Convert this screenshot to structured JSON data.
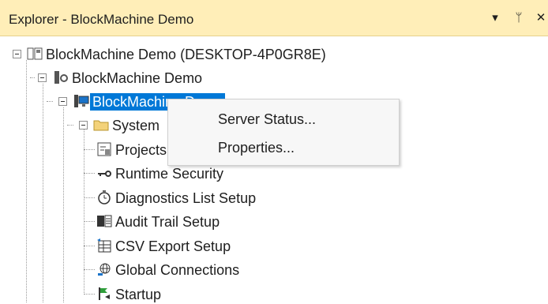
{
  "explorer": {
    "title": "Explorer - BlockMachine Demo",
    "controls": {
      "dropdown": "▾",
      "pin": "ᛘ",
      "close": "✕"
    }
  },
  "tree": {
    "root": "BlockMachine Demo (DESKTOP-4P0GR8E)",
    "project": "BlockMachine Demo",
    "server": "BlockMachine Demo",
    "system": "System",
    "items": [
      {
        "label": "Projects",
        "icon": "project-icon"
      },
      {
        "label": "Runtime Security",
        "icon": "key-icon"
      },
      {
        "label": "Diagnostics List Setup",
        "icon": "clock-icon"
      },
      {
        "label": "Audit Trail Setup",
        "icon": "audit-icon"
      },
      {
        "label": "CSV Export Setup",
        "icon": "csv-icon"
      },
      {
        "label": "Global Connections",
        "icon": "globe-icon"
      },
      {
        "label": "Startup",
        "icon": "flag-icon"
      }
    ]
  },
  "context_menu": {
    "items": [
      "Server Status...",
      "Properties..."
    ]
  },
  "colors": {
    "titlebar": "#ffeeb8",
    "selection": "#0078d7",
    "menu_bg": "#f7f7f7"
  }
}
